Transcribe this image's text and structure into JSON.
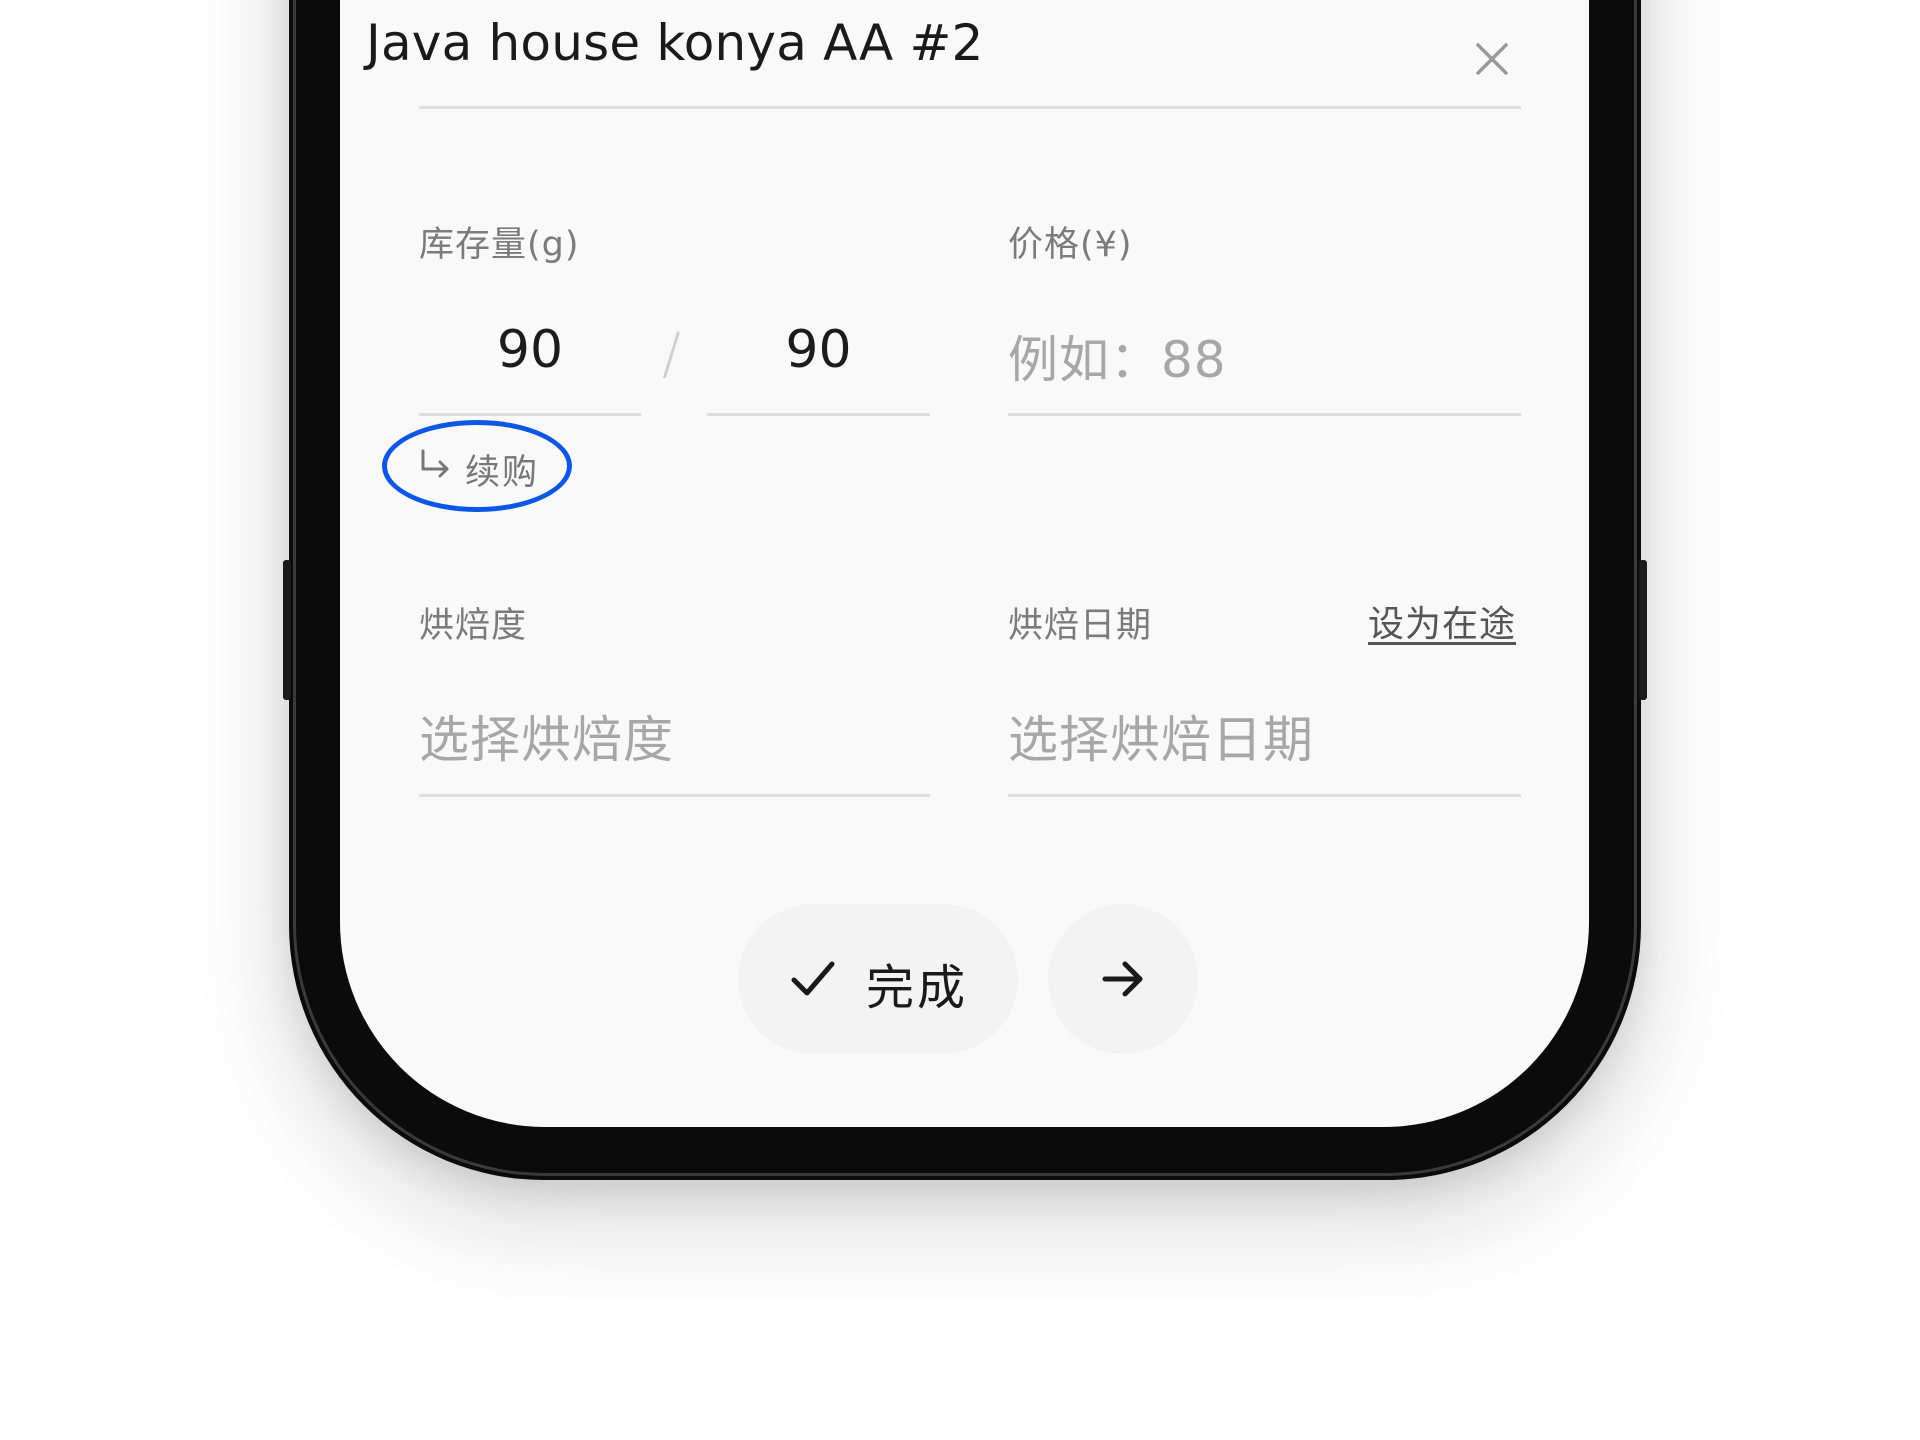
{
  "form": {
    "title": "Java house konya AA #2",
    "stock": {
      "label": "库存量(g)",
      "current": "90",
      "total": "90",
      "separator": "/"
    },
    "price": {
      "label": "价格(¥)",
      "placeholder": "例如：88"
    },
    "renew": {
      "label": "续购"
    },
    "roast_level": {
      "label": "烘焙度",
      "placeholder": "选择烘焙度"
    },
    "roast_date": {
      "label": "烘焙日期",
      "link": "设为在途",
      "placeholder": "选择烘焙日期"
    }
  },
  "actions": {
    "done_label": "完成"
  },
  "icons": {
    "close": "close-icon",
    "renew": "return-arrow-icon",
    "done": "checkmark-icon",
    "next": "arrow-right-icon"
  },
  "colors": {
    "highlight": "#0d56e6",
    "screen": "#f9f9f9",
    "button": "#f3f3f3"
  }
}
